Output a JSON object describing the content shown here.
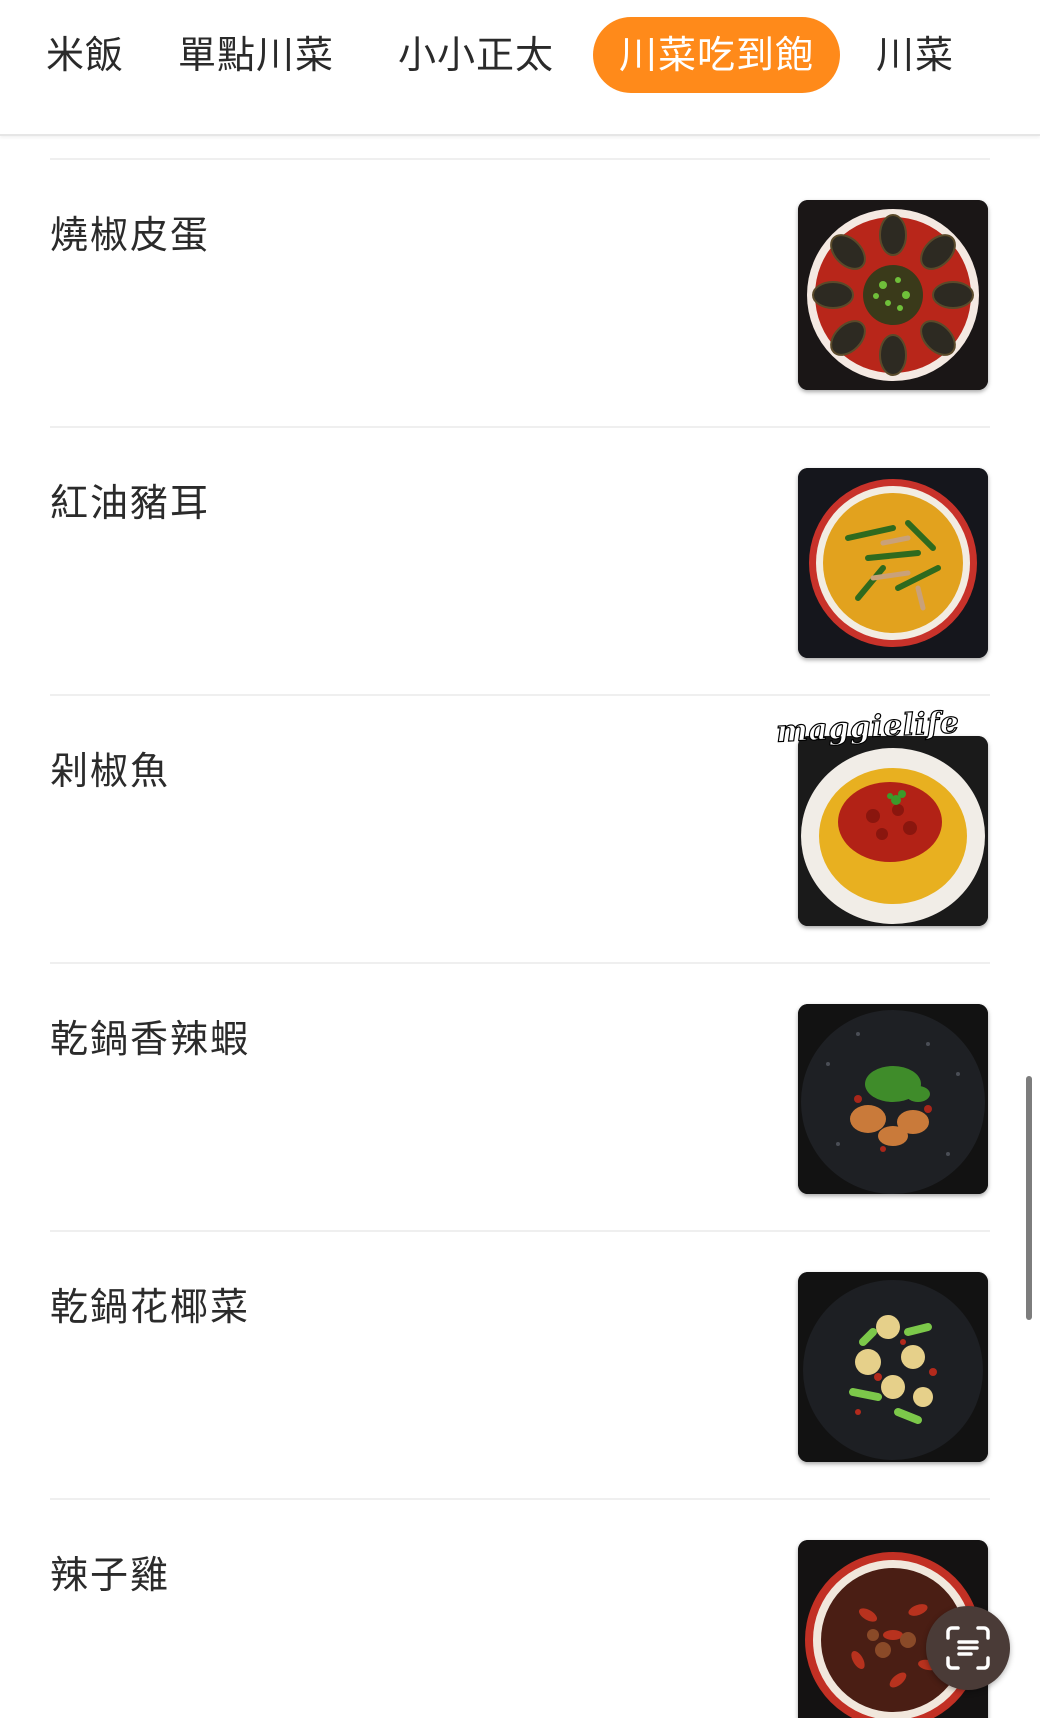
{
  "tabs": [
    {
      "label": "米飯",
      "active": false
    },
    {
      "label": "單點川菜",
      "active": false
    },
    {
      "label": "小小正太",
      "active": false
    },
    {
      "label": "川菜吃到飽",
      "active": true
    },
    {
      "label": "川菜",
      "active": false
    }
  ],
  "menu_items": [
    {
      "name": "燒椒皮蛋",
      "image": "century-egg-dish"
    },
    {
      "name": "紅油豬耳",
      "image": "pork-ear-dish"
    },
    {
      "name": "剁椒魚",
      "image": "chopped-chili-fish-dish"
    },
    {
      "name": "乾鍋香辣蝦",
      "image": "dry-pot-shrimp-dish"
    },
    {
      "name": "乾鍋花椰菜",
      "image": "dry-pot-cauliflower-dish"
    },
    {
      "name": "辣子雞",
      "image": "chili-chicken-dish"
    }
  ],
  "watermark": "maggielife",
  "floating_button": {
    "icon": "scan-text-icon"
  },
  "colors": {
    "accent": "#ff8a1a",
    "divider": "#efefef",
    "button_bg": "#4a3b37"
  }
}
